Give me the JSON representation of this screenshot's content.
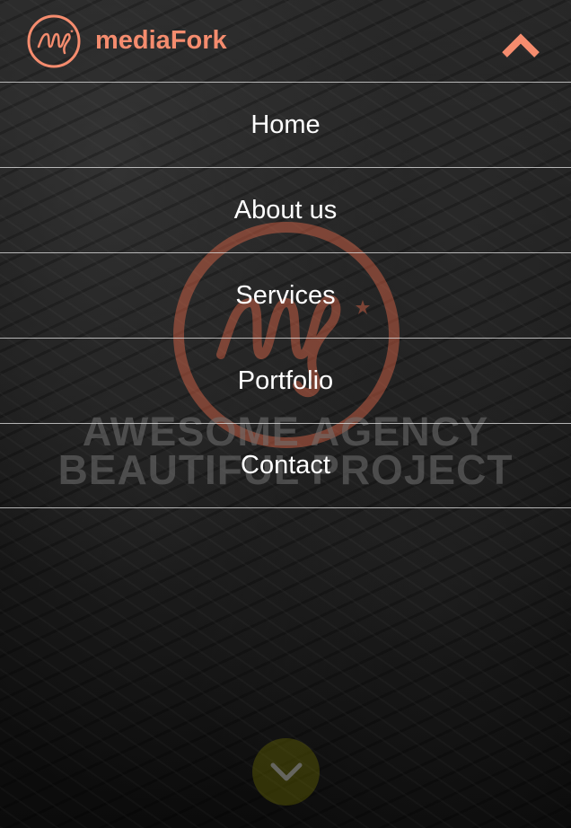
{
  "header": {
    "brand_name": "mediaFork",
    "logo_icon": "mf-logo-icon",
    "toggle_icon": "chevron-up-icon"
  },
  "hero": {
    "line1": "AWESOME AGENCY",
    "line2": "BEAUTIFUL PROJECT",
    "logo_icon": "mf-logo-icon"
  },
  "menu": {
    "items": [
      {
        "label": "Home"
      },
      {
        "label": "About us"
      },
      {
        "label": "Services"
      },
      {
        "label": "Portfolio"
      },
      {
        "label": "Contact"
      }
    ]
  },
  "scroll": {
    "icon": "chevron-down-icon"
  },
  "colors": {
    "brand": "#f58c6e",
    "scroll_button": "#7a7a00"
  }
}
